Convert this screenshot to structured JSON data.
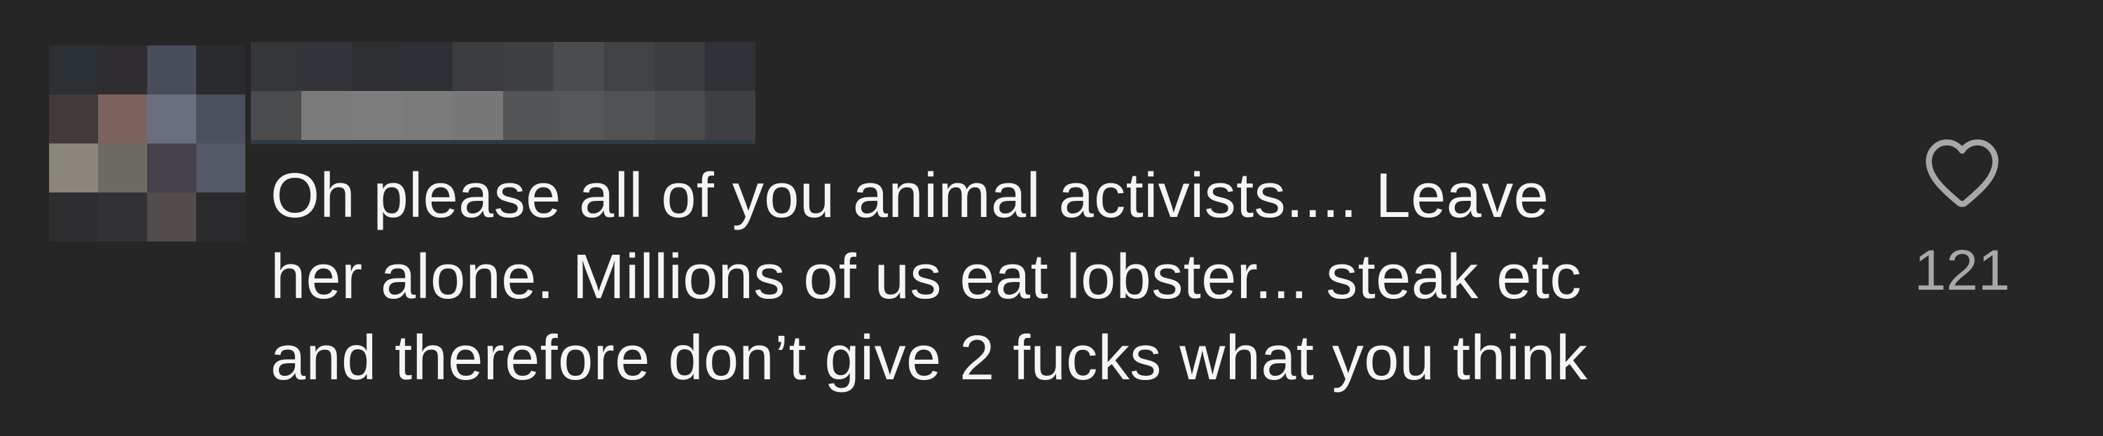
{
  "comment": {
    "author": {
      "avatar": {
        "redacted": true,
        "pixel_colors": [
          "#2b3034",
          "#302d30",
          "#474d59",
          "#2a2b2e",
          "#413a38",
          "#7c625d",
          "#6a6d7d",
          "#4b505e",
          "#8a857d",
          "#6d6964",
          "#44414a",
          "#555866",
          "#2e2e31",
          "#323236",
          "#524c4c",
          "#2a2a2d"
        ]
      },
      "username": {
        "redacted": true,
        "row1_colors": [
          "#34363a",
          "#33353a",
          "#2d2f33",
          "#2d3034",
          "#3a3c40",
          "#3e4044",
          "#4a4c50",
          "#404246",
          "#3a3d40",
          "#2f3236"
        ],
        "row2_colors": [
          "#4a4b4d",
          "#7a7a7a",
          "#7d7d7d",
          "#7b7b7b",
          "#787878",
          "#545556",
          "#565758",
          "#515254",
          "#4a4b4d",
          "#3f4043"
        ]
      }
    },
    "text_lines": [
      "Oh please all of you animal activists.... Leave",
      "her alone. Millions of us eat lobster... steak etc",
      "and therefore don’t give 2 fucks what you think"
    ],
    "like_icon": "heart-outline-icon",
    "like_count": "121",
    "colors": {
      "background": "#262626",
      "text": "#f5f5f5",
      "secondary_text": "#a8a8a8"
    }
  }
}
